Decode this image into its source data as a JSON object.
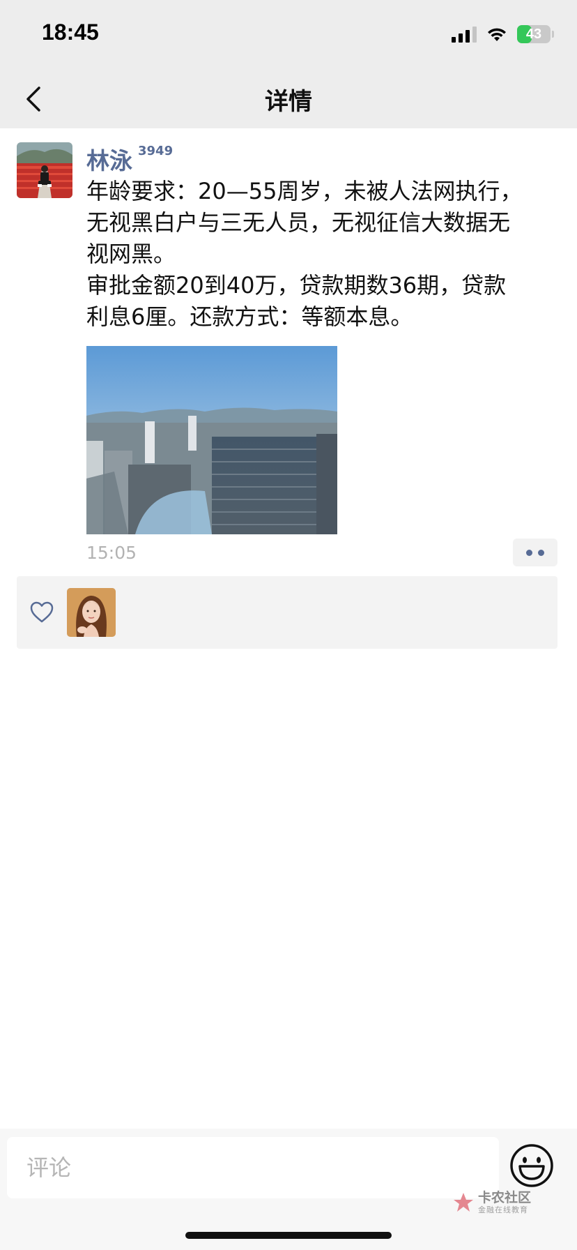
{
  "status_bar": {
    "time": "18:45",
    "battery_level": "43",
    "battery_fraction": 0.43,
    "signal_bars": 4,
    "signal_active_bars": 3
  },
  "nav": {
    "title": "详情",
    "back_icon": "chevron-left-icon"
  },
  "post": {
    "author": "林泳",
    "badge": "3949",
    "lines": [
      "年龄要求：20—55周岁，未被人法网执行，",
      "无视黑白户与三无人员，无视征信大数据无",
      "视网黑。",
      "审批金额20到40万，贷款期数36期，贷款",
      "利息6厘。还款方式：等额本息。"
    ],
    "time": "15:05"
  },
  "likes": {
    "icon": "heart-outline-icon",
    "count": 1
  },
  "comment": {
    "placeholder": "评论",
    "emoji_icon": "smiley-face-icon"
  },
  "watermark": {
    "main": "卡农社区",
    "sub": "金融在线教育"
  },
  "colors": {
    "accent_link": "#576b95",
    "header_bg": "#ededed",
    "battery_green": "#34c759"
  }
}
